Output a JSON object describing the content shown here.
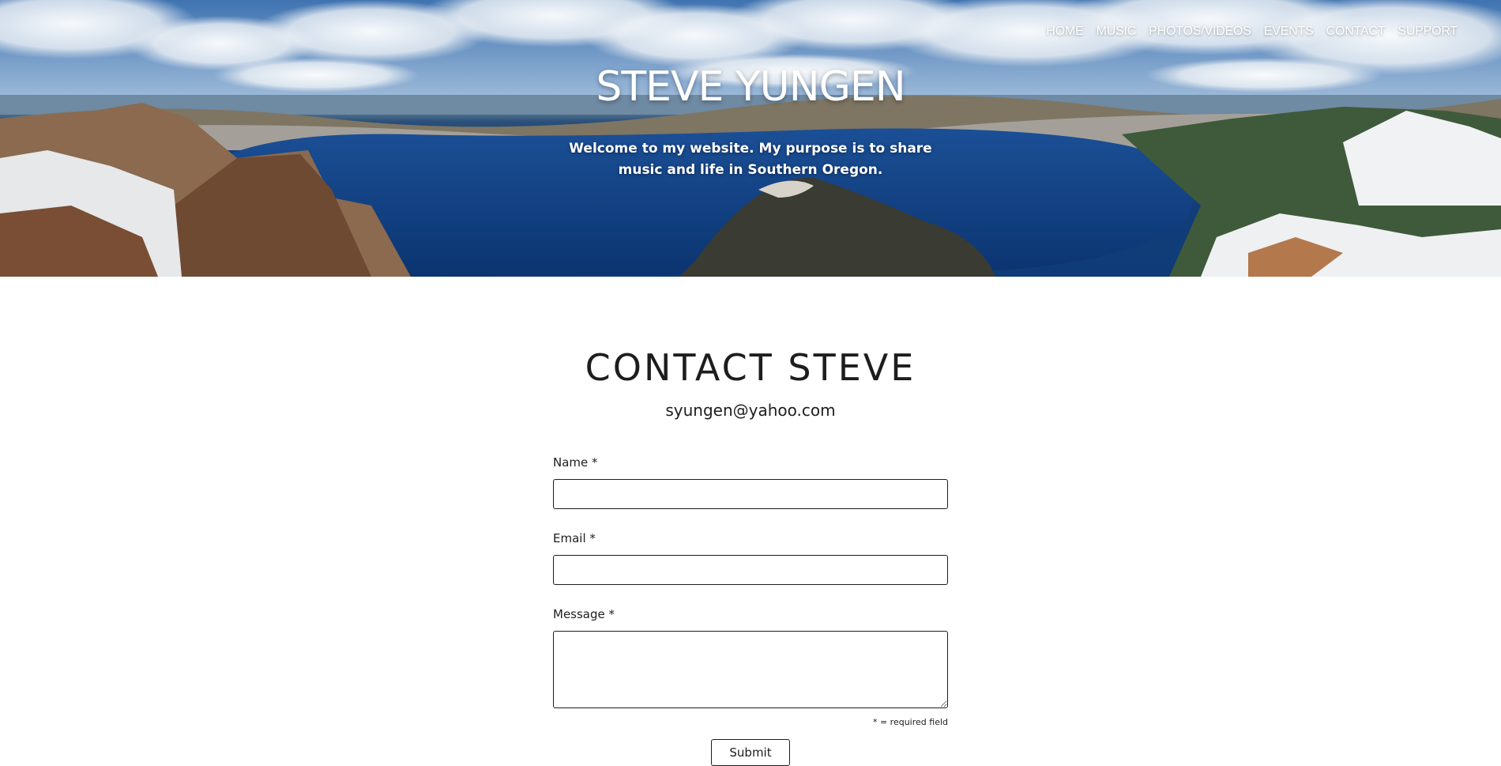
{
  "nav": {
    "items": [
      {
        "label": "HOME"
      },
      {
        "label": "MUSIC"
      },
      {
        "label": "PHOTOS/VIDEOS"
      },
      {
        "label": "EVENTS"
      },
      {
        "label": "CONTACT"
      },
      {
        "label": "SUPPORT"
      }
    ]
  },
  "hero": {
    "title": "STEVE YUNGEN",
    "tagline": "Welcome to my website. My purpose is to share music and life in Southern Oregon."
  },
  "contact": {
    "heading": "CONTACT STEVE",
    "email": "syungen@yahoo.com",
    "form": {
      "name_label": "Name *",
      "name_value": "",
      "email_label": "Email *",
      "email_value": "",
      "message_label": "Message *",
      "message_value": "",
      "required_note": "* = required field",
      "submit_label": "Submit"
    }
  },
  "colors": {
    "text": "#1d1d1d",
    "background": "#ffffff",
    "hero_lake": "#0f3b77"
  }
}
